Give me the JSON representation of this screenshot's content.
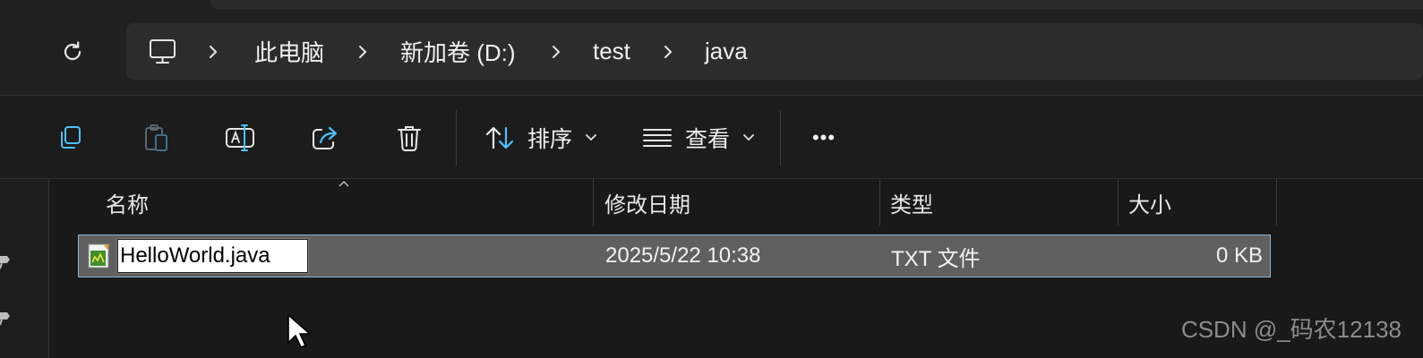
{
  "address": {
    "crumbs": [
      "此电脑",
      "新加卷 (D:)",
      "test",
      "java"
    ]
  },
  "toolbar": {
    "sort_label": "排序",
    "view_label": "查看",
    "more_label": "•••"
  },
  "columns": {
    "name": "名称",
    "modified": "修改日期",
    "type": "类型",
    "size": "大小"
  },
  "file": {
    "name": "HelloWorld.java",
    "modified": "2025/5/22 10:38",
    "type": "TXT 文件",
    "size": "0 KB"
  },
  "watermark": "CSDN @_码农12138",
  "icons": [
    "refresh-icon",
    "this-pc-icon",
    "chevron-right-icon",
    "copy-icon",
    "paste-icon",
    "rename-icon",
    "share-icon",
    "delete-icon",
    "sort-icon",
    "view-icon",
    "chevron-down-icon",
    "more-icon",
    "text-file-icon",
    "pin-icon",
    "mouse-cursor"
  ],
  "colors": {
    "accent": "#4cc2ff",
    "selection": "#606060",
    "background": "#191919"
  }
}
